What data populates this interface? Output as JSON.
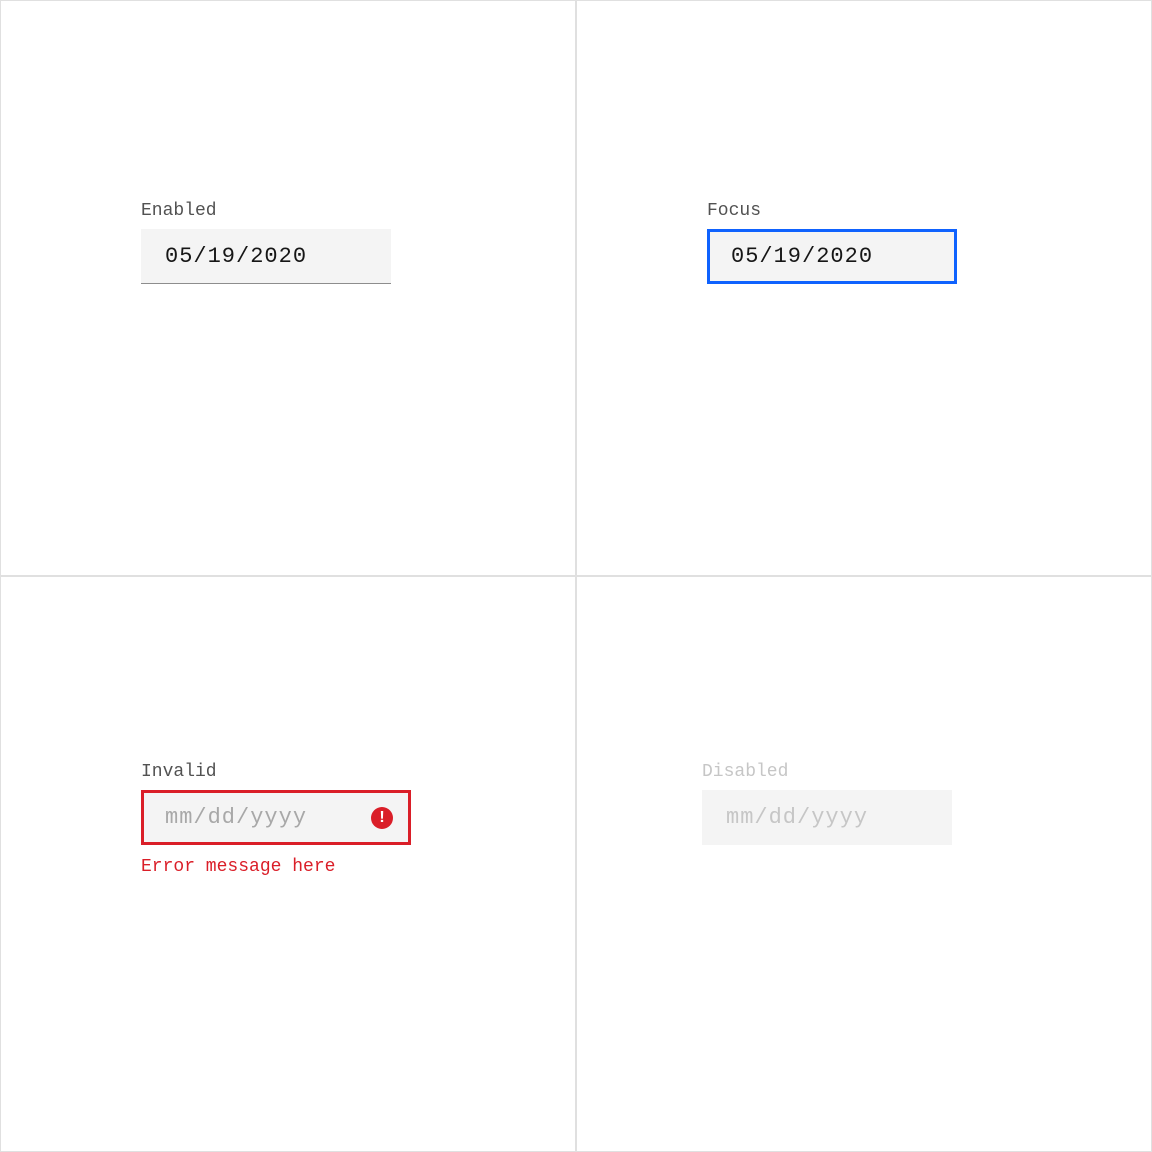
{
  "quadrants": {
    "enabled": {
      "label": "Enabled",
      "value": "05/19/2020"
    },
    "focus": {
      "label": "Focus",
      "value": "05/19/2020"
    },
    "invalid": {
      "label": "Invalid",
      "placeholder": "mm/dd/yyyy",
      "error_message": "Error message here"
    },
    "disabled": {
      "label": "Disabled",
      "placeholder": "mm/dd/yyyy"
    }
  }
}
